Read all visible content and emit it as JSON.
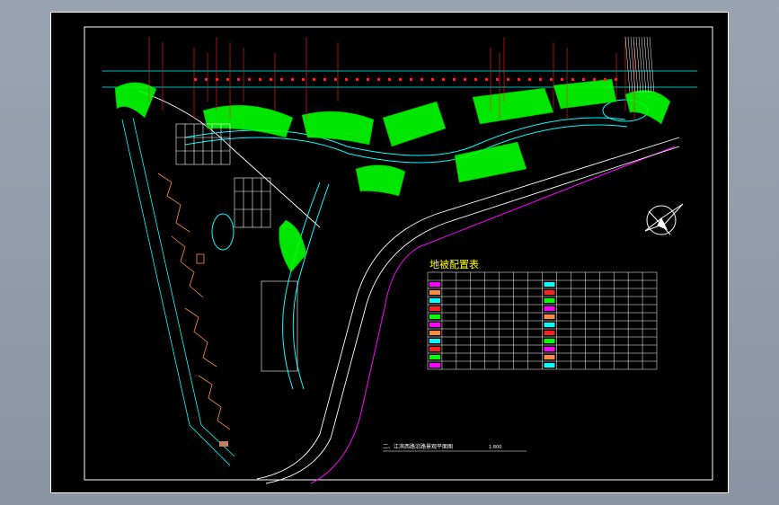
{
  "drawing": {
    "legend_title": "地被配置表",
    "caption_label": "二、江滨西路沿路景观平面图",
    "scale": "1:800",
    "colors": {
      "background": "#000000",
      "frame": "#ffffff",
      "grass": "#00ff00",
      "water": "#00ffff",
      "road": "#ffffff",
      "red_label": "#ff2020",
      "magenta": "#ff00ff",
      "building": "#ff8c40",
      "title": "#ffff00"
    },
    "legend_table": {
      "rows": 12,
      "cols": 16
    },
    "icons": [
      "north-arrow-icon"
    ]
  }
}
